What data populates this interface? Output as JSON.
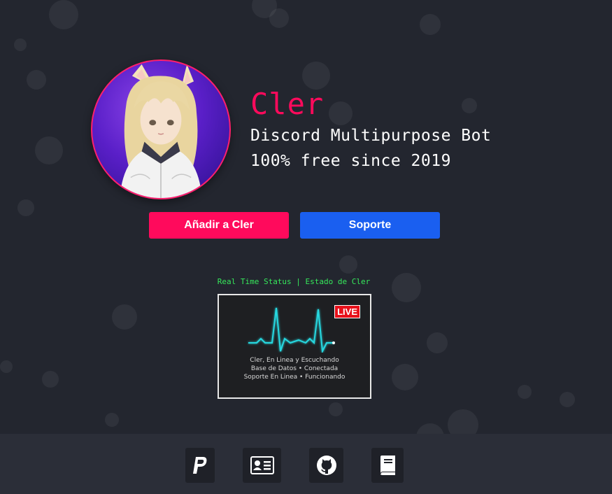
{
  "profile": {
    "bot_name": "Cler",
    "tagline_1": "Discord Multipurpose Bot",
    "tagline_2": "100% free since 2019",
    "avatar_icon": "anime-girl-avatar"
  },
  "buttons": {
    "add_label": "Añadir a Cler",
    "support_label": "Soporte"
  },
  "status": {
    "label": "Real Time Status | Estado de Cler",
    "badge": "LIVE",
    "line_1": "Cler, En Linea y Escuchando",
    "line_2": "Base de Datos • Conectada",
    "line_3": "Soporte En Linea • Funcionando"
  },
  "footer": {
    "icons": [
      "paypal-icon",
      "id-card-icon",
      "github-icon",
      "book-icon"
    ]
  },
  "colors": {
    "background": "#23262f",
    "accent_pink": "#ff0a5c",
    "accent_blue": "#1a5ff0",
    "status_green": "#36e85b",
    "footer": "#2b2e38"
  }
}
